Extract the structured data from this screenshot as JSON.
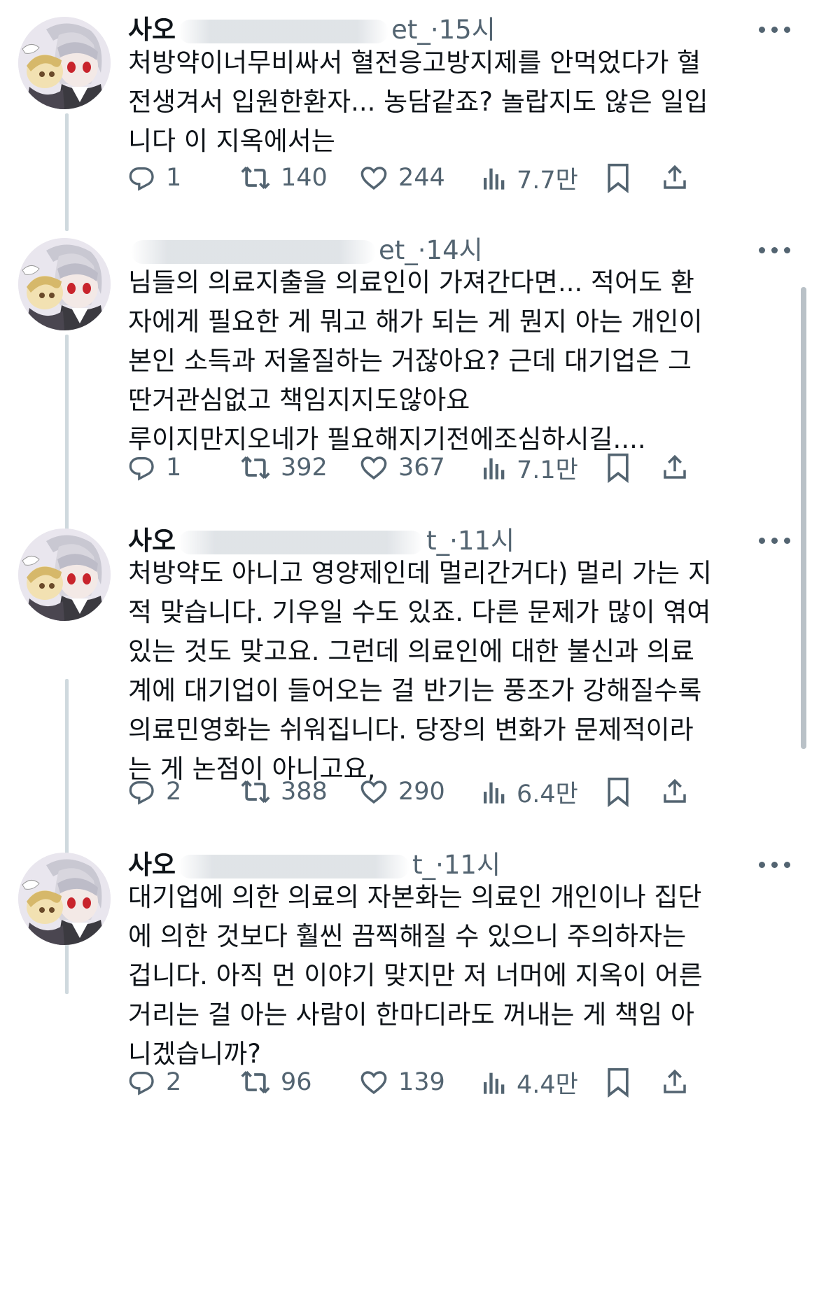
{
  "tweets": [
    {
      "name": "사오",
      "handle": "et_",
      "separator": "·",
      "time": "15시",
      "lines": [
        "처방약이너무비싸서 혈전응고방지제를 안먹었다가 혈",
        "전생겨서 입원한환자... 농담같죠? 놀랍지도 않은 일입",
        "니다 이 지옥에서는"
      ],
      "replies": "1",
      "retweets": "140",
      "likes": "244",
      "views": "7.7만"
    },
    {
      "name": "",
      "handle": "et_",
      "separator": "·",
      "time": "14시",
      "lines": [
        "님들의 의료지출을 의료인이 가져간다면... 적어도 환",
        "자에게 필요한 게 뭐고 해가 되는 게 뭔지 아는 개인이",
        "본인 소득과 저울질하는 거잖아요? 근데 대기업은 그",
        "딴거관심없고 책임지지도않아요",
        "루이지만지오네가 필요해지기전에조심하시길...."
      ],
      "replies": "1",
      "retweets": "392",
      "likes": "367",
      "views": "7.1만"
    },
    {
      "name": "사오",
      "handle": "t_",
      "separator": "·",
      "time": "11시",
      "lines": [
        "처방약도 아니고 영양제인데 멀리간거다) 멀리 가는 지",
        "적 맞습니다. 기우일 수도 있죠. 다른 문제가 많이 엮여",
        "있는 것도 맞고요. 그런데 의료인에 대한 불신과 의료",
        "계에 대기업이 들어오는 걸 반기는 풍조가 강해질수록",
        "의료민영화는 쉬워집니다. 당장의 변화가 문제적이라",
        "는 게 논점이 아니고요,"
      ],
      "replies": "2",
      "retweets": "388",
      "likes": "290",
      "views": "6.4만"
    },
    {
      "name": "사오",
      "handle": "t_",
      "separator": "·",
      "time": "11시",
      "lines": [
        "대기업에 의한 의료의 자본화는 의료인 개인이나 집단",
        "에 의한 것보다 훨씬 끔찍해질 수 있으니 주의하자는",
        "겁니다. 아직 먼 이야기 맞지만 저 너머에 지옥이 어른",
        "거리는 걸 아는 사람이 한마디라도 꺼내는 게 책임 아",
        "니겠습니까?"
      ],
      "replies": "2",
      "retweets": "96",
      "likes": "139",
      "views": "4.4만"
    }
  ],
  "icons": {
    "reply": "reply-icon",
    "retweet": "retweet-icon",
    "like": "heart-icon",
    "views": "views-icon",
    "bookmark": "bookmark-icon",
    "share": "share-icon",
    "more": "more-icon"
  },
  "colors": {
    "text": "#0f1419",
    "secondary": "#536471",
    "thread_line": "#cfd9de"
  }
}
